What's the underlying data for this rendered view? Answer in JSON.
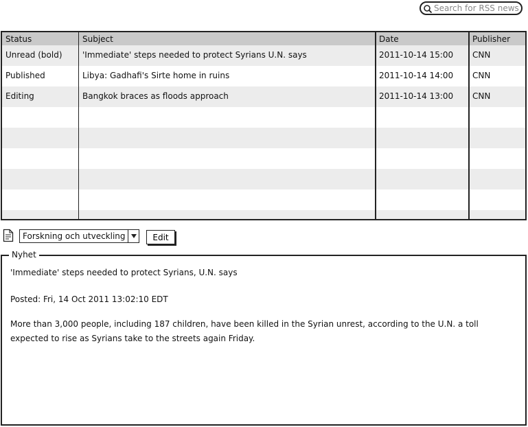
{
  "search": {
    "placeholder": "Search for RSS news"
  },
  "table": {
    "columns": [
      "Status",
      "Subject",
      "Date",
      "Publisher"
    ],
    "rows": [
      {
        "status": "Unread (bold)",
        "subject": "'Immediate' steps needed to protect Syrians U.N. says",
        "date": "2011-10-14 15:00",
        "publisher": "CNN"
      },
      {
        "status": "Published",
        "subject": "Libya: Gadhafi's Sirte home in ruins",
        "date": "2011-10-14 14:00",
        "publisher": "CNN"
      },
      {
        "status": "Editing",
        "subject": "Bangkok braces as floods approach",
        "date": "2011-10-14 13:00",
        "publisher": "CNN"
      }
    ]
  },
  "toolbar": {
    "category": "Forskning och utveckling",
    "edit_label": "Edit"
  },
  "detail": {
    "legend": "Nyhet",
    "title": "'Immediate' steps needed to protect Syrians, U.N. says",
    "posted": "Posted: Fri, 14 Oct 2011 13:02:10 EDT",
    "body_line1": "More than 3,000 people, including 187 children, have been killed in the Syrian unrest, according to the U.N.  a toll",
    "body_line2": "expected to rise as Syrians take to the streets again Friday."
  }
}
